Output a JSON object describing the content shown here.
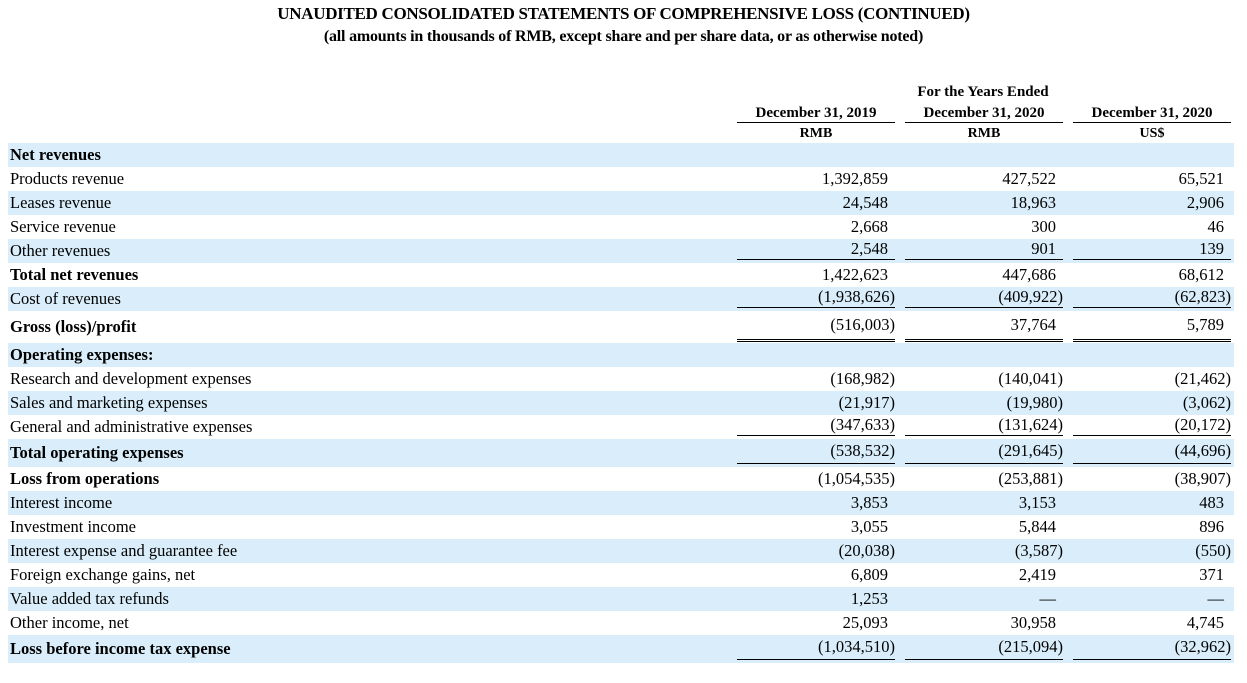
{
  "title": "UNAUDITED CONSOLIDATED STATEMENTS OF COMPREHENSIVE LOSS (CONTINUED)",
  "subtitle": "(all amounts in thousands of RMB, except share and per share data, or as otherwise noted)",
  "header": {
    "top": "For the Years Ended",
    "columns": [
      {
        "date": "December 31, 2019",
        "unit": "RMB"
      },
      {
        "date": "December 31, 2020",
        "unit": "RMB"
      },
      {
        "date": "December 31, 2020",
        "unit": "US$"
      }
    ]
  },
  "rows": [
    {
      "label": "Net revenues",
      "values": [
        "",
        "",
        ""
      ]
    },
    {
      "label": "Products revenue",
      "values": [
        "1,392,859",
        "427,522",
        "65,521"
      ]
    },
    {
      "label": "Leases revenue",
      "values": [
        "24,548",
        "18,963",
        "2,906"
      ]
    },
    {
      "label": "Service revenue",
      "values": [
        "2,668",
        "300",
        "46"
      ]
    },
    {
      "label": "Other revenues",
      "values": [
        "2,548",
        "901",
        "139"
      ]
    },
    {
      "label": "Total net revenues",
      "values": [
        "1,422,623",
        "447,686",
        "68,612"
      ]
    },
    {
      "label": "Cost of revenues",
      "values": [
        "(1,938,626)",
        "(409,922)",
        "(62,823)"
      ]
    },
    {
      "label": "Gross (loss)/profit",
      "values": [
        "(516,003)",
        "37,764",
        "5,789"
      ]
    },
    {
      "label": "Operating expenses:",
      "values": [
        "",
        "",
        ""
      ]
    },
    {
      "label": "Research and development expenses",
      "values": [
        "(168,982)",
        "(140,041)",
        "(21,462)"
      ]
    },
    {
      "label": "Sales and marketing expenses",
      "values": [
        "(21,917)",
        "(19,980)",
        "(3,062)"
      ]
    },
    {
      "label": "General and administrative expenses",
      "values": [
        "(347,633)",
        "(131,624)",
        "(20,172)"
      ]
    },
    {
      "label": "Total operating expenses",
      "values": [
        "(538,532)",
        "(291,645)",
        "(44,696)"
      ]
    },
    {
      "label": "Loss from operations",
      "values": [
        "(1,054,535)",
        "(253,881)",
        "(38,907)"
      ]
    },
    {
      "label": "Interest income",
      "values": [
        "3,853",
        "3,153",
        "483"
      ]
    },
    {
      "label": "Investment income",
      "values": [
        "3,055",
        "5,844",
        "896"
      ]
    },
    {
      "label": "Interest expense and guarantee fee",
      "values": [
        "(20,038)",
        "(3,587)",
        "(550)"
      ]
    },
    {
      "label": "Foreign exchange gains, net",
      "values": [
        "6,809",
        "2,419",
        "371"
      ]
    },
    {
      "label": "Value added tax refunds",
      "values": [
        "1,253",
        "—",
        "—"
      ]
    },
    {
      "label": "Other income, net",
      "values": [
        "25,093",
        "30,958",
        "4,745"
      ]
    },
    {
      "label": "Loss before income tax expense",
      "values": [
        "(1,034,510)",
        "(215,094)",
        "(32,962)"
      ]
    }
  ]
}
